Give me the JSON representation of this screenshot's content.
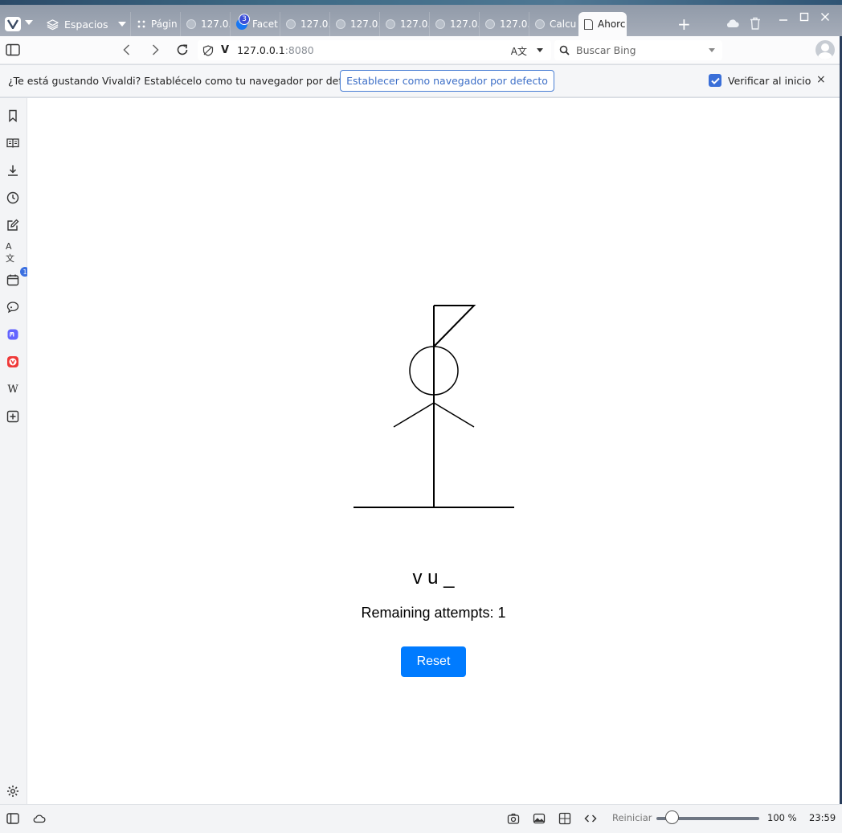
{
  "browser": {
    "spaces_label": "Espacios",
    "tabs": [
      {
        "label": "Págin",
        "favicon": "grid-icon"
      },
      {
        "label": "127.0.",
        "favicon": "globe-icon"
      },
      {
        "label": "Facet",
        "favicon": "facebook-icon",
        "badge": "3"
      },
      {
        "label": "127.0.",
        "favicon": "globe-icon"
      },
      {
        "label": "127.0.",
        "favicon": "globe-icon"
      },
      {
        "label": "127.0.",
        "favicon": "globe-icon"
      },
      {
        "label": "127.0.",
        "favicon": "globe-icon"
      },
      {
        "label": "127.0.",
        "favicon": "globe-icon"
      },
      {
        "label": "127.0.",
        "favicon": "globe-icon"
      },
      {
        "label": "Calcu",
        "favicon": "globe-icon"
      },
      {
        "label": "Ahorc",
        "favicon": "page-icon",
        "active": true
      }
    ],
    "new_tab": "+",
    "url_host": "127.0.0.1",
    "url_port": ":8080",
    "search_placeholder": "Buscar Bing",
    "notification": {
      "message": "¿Te está gustando Vivaldi? Establécelo como tu navegador por defecto.",
      "set_default_label": "Establecer como navegador por defecto",
      "checkbox_label": "Verificar al inicio",
      "close_label": "×"
    },
    "status": {
      "reset_zoom_label": "Reiniciar",
      "zoom_percent": "100 %",
      "zoom_value": 100,
      "clock": "23:59"
    },
    "sidepanel_icons": [
      "bookmark-icon",
      "reading-list-icon",
      "download-icon",
      "history-icon",
      "notes-icon",
      "translate-icon",
      "calendar-icon",
      "feed-icon",
      "mastodon-icon",
      "vivaldi-icon",
      "wikipedia-icon",
      "add-panel-icon"
    ],
    "calendar_badge": "1",
    "colors": {
      "accent": "#3a6fd8",
      "reset_button": "#007bff"
    }
  },
  "game": {
    "word_display": "v u _",
    "remaining_label": "Remaining attempts: 1",
    "remaining": 1,
    "reset_label": "Reset"
  }
}
